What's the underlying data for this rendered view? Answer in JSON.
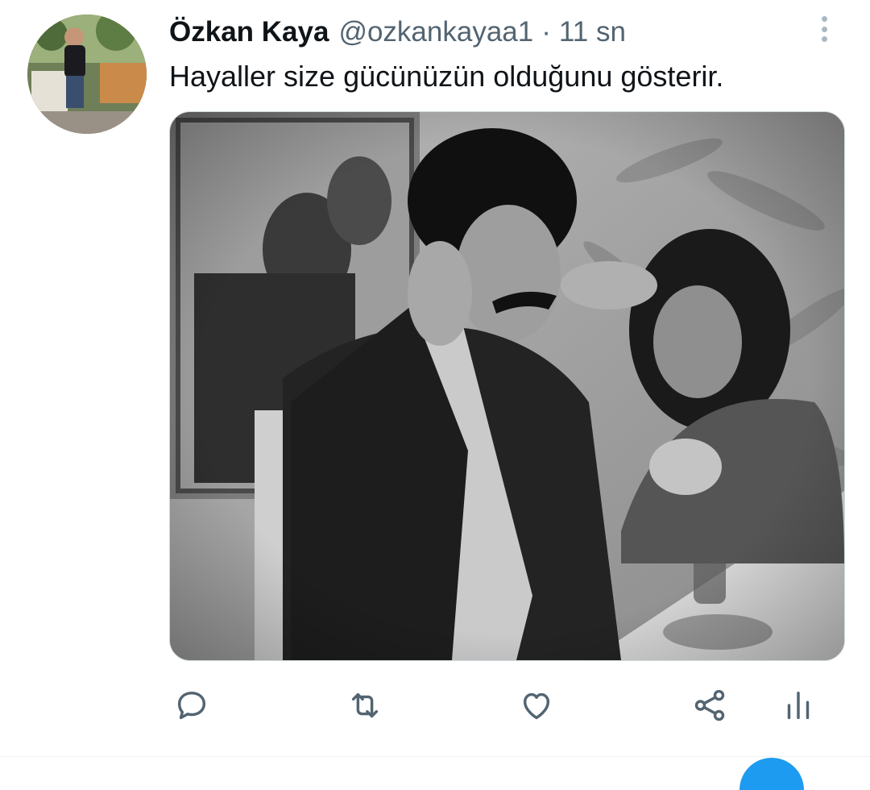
{
  "tweet": {
    "author_name": "Özkan Kaya",
    "author_handle": "@ozkankayaa1",
    "separator": "·",
    "timestamp": "11 sn",
    "text": "Hayaller size gücünüzün olduğunu gösterir."
  },
  "icons": {
    "more": "more-vertical-icon",
    "reply": "reply-icon",
    "retweet": "retweet-icon",
    "like": "like-icon",
    "share": "share-icon",
    "analytics": "analytics-icon"
  },
  "colors": {
    "text_primary": "#0f1419",
    "text_secondary": "#536471",
    "icon_gray": "#536471",
    "accent": "#1d9bf0"
  }
}
